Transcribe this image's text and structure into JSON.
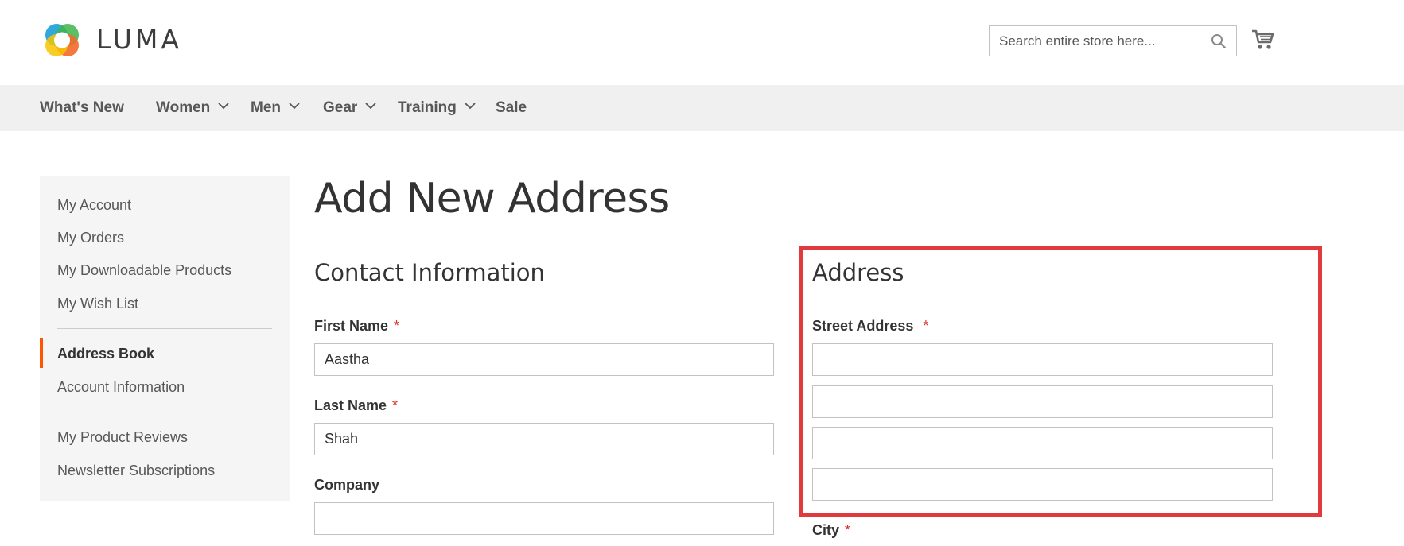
{
  "header": {
    "logo_text": "LUMA",
    "search_placeholder": "Search entire store here...",
    "icons": {
      "search": "search-icon",
      "cart": "cart-icon"
    }
  },
  "nav": {
    "items": [
      {
        "label": "What's New",
        "has_dropdown": false
      },
      {
        "label": "Women",
        "has_dropdown": true
      },
      {
        "label": "Men",
        "has_dropdown": true
      },
      {
        "label": "Gear",
        "has_dropdown": true
      },
      {
        "label": "Training",
        "has_dropdown": true
      },
      {
        "label": "Sale",
        "has_dropdown": false
      }
    ]
  },
  "sidebar": {
    "items": [
      {
        "label": "My Account"
      },
      {
        "label": "My Orders"
      },
      {
        "label": "My Downloadable Products"
      },
      {
        "label": "My Wish List"
      },
      {
        "label": "Address Book",
        "active": true
      },
      {
        "label": "Account Information"
      },
      {
        "label": "My Product Reviews"
      },
      {
        "label": "Newsletter Subscriptions"
      }
    ],
    "active_color": "#ff5501"
  },
  "main": {
    "page_title": "Add New Address",
    "contact": {
      "title": "Contact Information",
      "first_name_label": "First Name",
      "first_name_value": "Aastha",
      "last_name_label": "Last Name",
      "last_name_value": "Shah",
      "company_label": "Company",
      "company_value": ""
    },
    "address": {
      "title": "Address",
      "street_label": "Street Address",
      "street_values": [
        "",
        "",
        "",
        ""
      ],
      "city_label": "City"
    },
    "required_marker": "*",
    "highlight_color": "#e0393e"
  }
}
